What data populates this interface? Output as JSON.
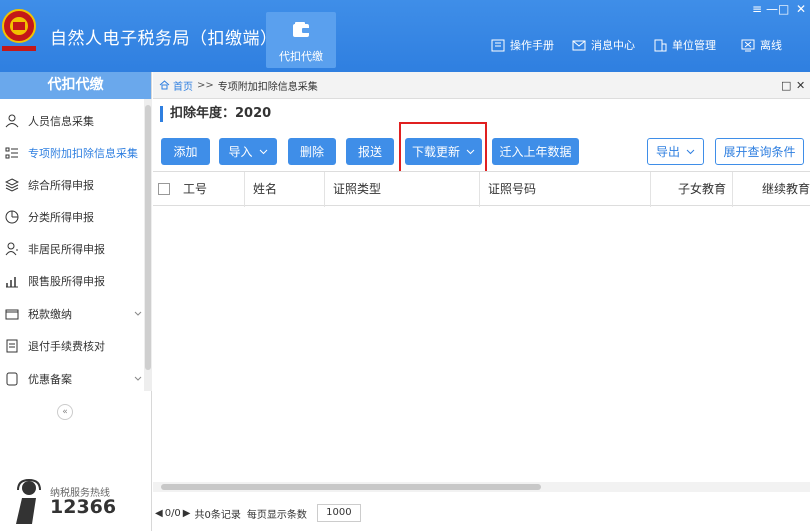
{
  "app": {
    "title": "自然人电子税务局（扣缴端）"
  },
  "top_nav": {
    "active_label": "代扣代缴"
  },
  "window_controls": {
    "menu": "≡",
    "minimize": "—",
    "maximize": "□",
    "close": "✕"
  },
  "top_links": [
    {
      "label": "操作手册",
      "icon": "manual-icon"
    },
    {
      "label": "消息中心",
      "icon": "mail-icon"
    },
    {
      "label": "单位管理",
      "icon": "building-icon"
    },
    {
      "label": "离线",
      "icon": "offline-icon"
    }
  ],
  "sidebar": {
    "header": "代扣代缴",
    "items": [
      {
        "label": "人员信息采集",
        "icon": "person-icon"
      },
      {
        "label": "专项附加扣除信息采集",
        "icon": "list-icon",
        "active": true
      },
      {
        "label": "综合所得申报",
        "icon": "layers-icon"
      },
      {
        "label": "分类所得申报",
        "icon": "pie-icon"
      },
      {
        "label": "非居民所得申报",
        "icon": "person-alt-icon"
      },
      {
        "label": "限售股所得申报",
        "icon": "bar-chart-icon"
      },
      {
        "label": "税款缴纳",
        "icon": "wallet-icon"
      },
      {
        "label": "退付手续费核对",
        "icon": "receipt-icon"
      },
      {
        "label": "优惠备案",
        "icon": "doc-icon"
      }
    ],
    "collapse": "«",
    "hotline_label": "纳税服务热线",
    "hotline_number": "12366"
  },
  "breadcrumb": {
    "home": "首页",
    "separator": ">>",
    "current": "专项附加扣除信息采集"
  },
  "year": {
    "label": "扣除年度：2020"
  },
  "toolbar": {
    "add": "添加",
    "import": "导入",
    "delete": "删除",
    "submit": "报送",
    "download_update": "下载更新",
    "move_last_year": "迁入上年数据",
    "export": "导出",
    "expand_query": "展开查询条件"
  },
  "table": {
    "columns": [
      "工号",
      "姓名",
      "证照类型",
      "证照号码",
      "子女教育",
      "继续教育"
    ],
    "rows": []
  },
  "pager": {
    "page": "0/0",
    "total": "共0条记录",
    "per_page_label": "每页显示条数",
    "per_page": "1000"
  },
  "colors": {
    "primary": "#3f8ee8",
    "highlight_box": "#e02020"
  }
}
